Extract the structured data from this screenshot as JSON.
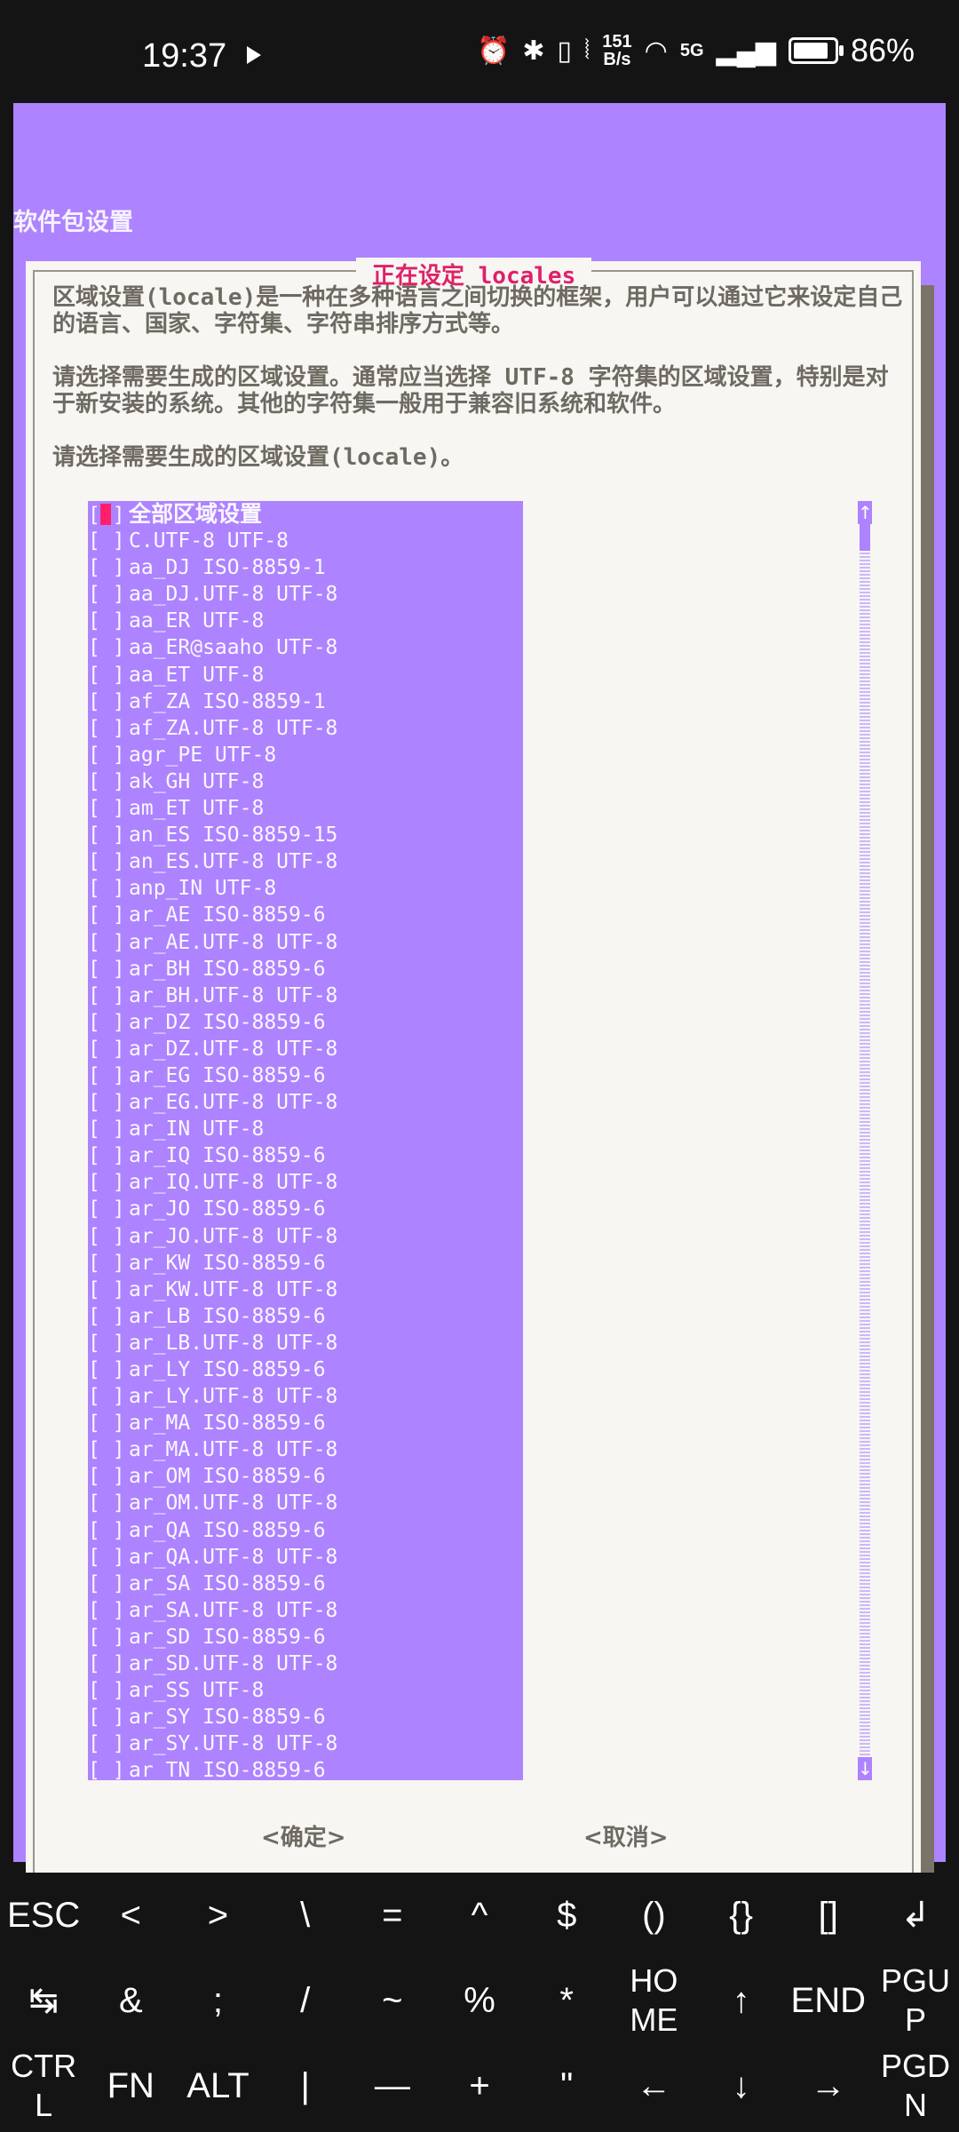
{
  "status_bar": {
    "time": "19:37",
    "net_speed_top": "151",
    "net_speed_bottom": "B/s",
    "network_label": "5G",
    "battery_percent": "86%",
    "battery_level": 0.86
  },
  "window": {
    "backtitle": "软件包设置"
  },
  "dialog": {
    "title": "正在设定 locales",
    "paragraph1": "区域设置(locale)是一种在多种语言之间切换的框架，用户可以通过它来设定自己的语言、国家、字符集、字符串排序方式等。",
    "paragraph2": "请选择需要生成的区域设置。通常应当选择 UTF-8 字符集的区域设置，特别是对于新安装的系统。其他的字符集一般用于兼容旧系统和软件。",
    "paragraph3": "请选择需要生成的区域设置(locale)。",
    "checkbox": "[ ]",
    "items": [
      "全部区域设置",
      "C.UTF-8 UTF-8",
      "aa_DJ ISO-8859-1",
      "aa_DJ.UTF-8 UTF-8",
      "aa_ER UTF-8",
      "aa_ER@saaho UTF-8",
      "aa_ET UTF-8",
      "af_ZA ISO-8859-1",
      "af_ZA.UTF-8 UTF-8",
      "agr_PE UTF-8",
      "ak_GH UTF-8",
      "am_ET UTF-8",
      "an_ES ISO-8859-15",
      "an_ES.UTF-8 UTF-8",
      "anp_IN UTF-8",
      "ar_AE ISO-8859-6",
      "ar_AE.UTF-8 UTF-8",
      "ar_BH ISO-8859-6",
      "ar_BH.UTF-8 UTF-8",
      "ar_DZ ISO-8859-6",
      "ar_DZ.UTF-8 UTF-8",
      "ar_EG ISO-8859-6",
      "ar_EG.UTF-8 UTF-8",
      "ar_IN UTF-8",
      "ar_IQ ISO-8859-6",
      "ar_IQ.UTF-8 UTF-8",
      "ar_JO ISO-8859-6",
      "ar_JO.UTF-8 UTF-8",
      "ar_KW ISO-8859-6",
      "ar_KW.UTF-8 UTF-8",
      "ar_LB ISO-8859-6",
      "ar_LB.UTF-8 UTF-8",
      "ar_LY ISO-8859-6",
      "ar_LY.UTF-8 UTF-8",
      "ar_MA ISO-8859-6",
      "ar_MA.UTF-8 UTF-8",
      "ar_OM ISO-8859-6",
      "ar_OM.UTF-8 UTF-8",
      "ar_QA ISO-8859-6",
      "ar_QA.UTF-8 UTF-8",
      "ar_SA ISO-8859-6",
      "ar_SA.UTF-8 UTF-8",
      "ar_SD ISO-8859-6",
      "ar_SD.UTF-8 UTF-8",
      "ar_SS UTF-8",
      "ar_SY ISO-8859-6",
      "ar_SY.UTF-8 UTF-8",
      "ar_TN ISO-8859-6"
    ],
    "scroll_up": "↑",
    "scroll_down": "↓",
    "ok_button": "<确定>",
    "cancel_button": "<取消>"
  },
  "extra_keys": [
    [
      "ESC",
      "<",
      ">",
      "\\",
      "=",
      "^",
      "$",
      "()",
      "{}",
      "[]",
      "↲"
    ],
    [
      "↹",
      "&",
      ";",
      "/",
      "~",
      "%",
      "*",
      "HO\nME",
      "↑",
      "END",
      "PGU\nP"
    ],
    [
      "CTR\nL",
      "FN",
      "ALT",
      "|",
      "—",
      "+",
      "\"",
      "←",
      "↓",
      "→",
      "PGD\nN"
    ]
  ],
  "colors": {
    "backdrop": "#ad83ff",
    "dialog_bg": "#f7f6f2",
    "title": "#e0206a",
    "cursor": "#ff1f6d",
    "text": "#6e6a62"
  }
}
